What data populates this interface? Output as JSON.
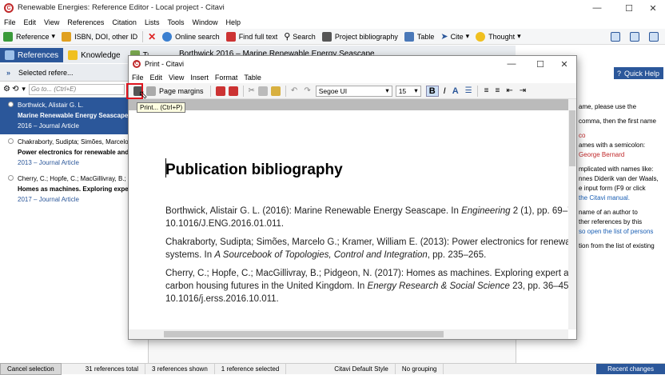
{
  "window": {
    "title": "Renewable Energies: Reference Editor - Local project - Citavi",
    "logo": "C"
  },
  "menu": [
    "File",
    "Edit",
    "View",
    "References",
    "Citation",
    "Lists",
    "Tools",
    "Window",
    "Help"
  ],
  "toolbar": {
    "reference": "Reference",
    "isbn": "ISBN, DOI, other ID",
    "online_search": "Online search",
    "find_full_text": "Find full text",
    "search": "Search",
    "project_bibliography": "Project bibliography",
    "table": "Table",
    "cite": "Cite",
    "thought": "Thought"
  },
  "tabs": {
    "references": "References",
    "knowledge": "Knowledge",
    "tasks": "Tasks"
  },
  "left": {
    "selected": "Selected refere...",
    "goto_placeholder": "Go to... (Ctrl+E)"
  },
  "references": [
    {
      "authors": "Borthwick, Alistair G. L.",
      "title": "Marine Renewable Energy Seascape",
      "meta": "2016 – Journal Article"
    },
    {
      "authors": "Chakraborty, Sudipta; Simões, Marcelo G.;",
      "title": "Power electronics for renewable and",
      "meta": "2013 – Journal Article"
    },
    {
      "authors": "Cherry, C.; Hopfe, C.; MacGillivray, B.; Pi",
      "title": "Homes as machines. Exploring expert",
      "meta": "2017 – Journal Article"
    }
  ],
  "editor_title": "Borthwick 2016 – Marine Renewable Energy Seascape",
  "help": {
    "button": "Quick Help",
    "lines": [
      {
        "text": "ame, please use the",
        "color": ""
      },
      {
        "text": "",
        "color": ""
      },
      {
        "text": "comma, then the first name",
        "color": ""
      },
      {
        "text": "",
        "color": ""
      },
      {
        "text": "co",
        "color": "#c0282a"
      },
      {
        "text": "ames with a semicolon:",
        "color": ""
      },
      {
        "text": "George Bernard",
        "color": "#c0282a"
      },
      {
        "text": "",
        "color": ""
      },
      {
        "text": "mplicated with names like:",
        "color": ""
      },
      {
        "text": "nnes Diderik van der Waals,",
        "color": ""
      },
      {
        "text": "e input form (F9 or click",
        "color": ""
      },
      {
        "text": "the Citavi manual.",
        "color": "#1a5fb4"
      },
      {
        "text": "",
        "color": ""
      },
      {
        "text": "name of an author to",
        "color": ""
      },
      {
        "text": "ther references by this",
        "color": ""
      },
      {
        "text": "so open the list of persons",
        "color": "#1a5fb4"
      },
      {
        "text": "",
        "color": ""
      },
      {
        "text": "tion from the list of existing",
        "color": ""
      }
    ]
  },
  "status": {
    "cancel": "Cancel selection",
    "total": "31 references total",
    "shown": "3 references shown",
    "selected": "1 reference selected",
    "style": "Citavi Default Style",
    "grouping": "No grouping",
    "changes": "Recent changes"
  },
  "dialog": {
    "title": "Print - Citavi",
    "menu": [
      "File",
      "Edit",
      "View",
      "Insert",
      "Format",
      "Table"
    ],
    "page_margins": "Page margins",
    "font": "Segoe UI",
    "size": "15",
    "tooltip": "Print... (Ctrl+P)",
    "doc_title": "Publication bibliography",
    "entries": [
      {
        "l1": "Borthwick, Alistair G. L. (2016): Marine Renewable Energy Seascape. In ",
        "l1i": "Engineering",
        "l1e": " 2 (1), pp. 69–78",
        "l2": "10.1016/J.ENG.2016.01.011.",
        "l2i": "",
        "l2e": "",
        "l3": ""
      },
      {
        "l1": "Chakraborty, Sudipta; Simões, Marcelo G.; Kramer, William E. (2013): Power electronics for renewab",
        "l1i": "",
        "l1e": "",
        "l2": "systems. In ",
        "l2i": "A Sourcebook of Topologies, Control and Integration",
        "l2e": ", pp. 235–265.",
        "l3": ""
      },
      {
        "l1": "Cherry, C.; Hopfe, C.; MacGillivray, B.; Pidgeon, N. (2017): Homes as machines. Exploring expert and",
        "l1i": "",
        "l1e": "",
        "l2": "carbon housing futures in the United Kingdom. In ",
        "l2i": "Energy Research & Social Science",
        "l2e": " 23, pp. 36–45.",
        "l3": "10.1016/j.erss.2016.10.011."
      }
    ]
  },
  "colors": {
    "accent": "#2b579a",
    "logo_red": "#c0282a",
    "highlight": "#e0131d"
  }
}
